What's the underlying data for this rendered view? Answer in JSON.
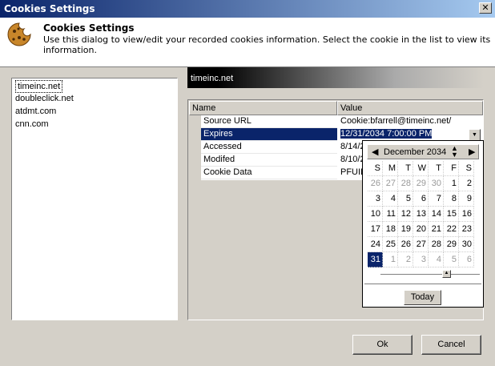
{
  "window": {
    "title": "Cookies Settings",
    "close": "✕"
  },
  "header": {
    "title": "Cookies Settings",
    "description": "Use this dialog to view/edit your recorded cookies information. Select the cookie in the list to view its information."
  },
  "cookies": [
    "timeinc.net",
    "doubleclick.net",
    "atdmt.com",
    "cnn.com"
  ],
  "selected_cookie": "timeinc.net",
  "grid": {
    "columns": [
      "Name",
      "Value"
    ],
    "rows": [
      {
        "name": "Source URL",
        "value": "Cookie:bfarrell@timeinc.net/"
      },
      {
        "name": "Expires",
        "value": "12/31/2034 7:00:00 PM"
      },
      {
        "name": "Accessed",
        "value": "8/14/2"
      },
      {
        "name": "Modifed",
        "value": "8/10/2"
      },
      {
        "name": "Cookie Data",
        "value": "PFUID"
      }
    ]
  },
  "calendar": {
    "month": "December 2034",
    "weekdays": [
      "S",
      "M",
      "T",
      "W",
      "T",
      "F",
      "S"
    ],
    "days": [
      [
        26,
        27,
        28,
        29,
        30,
        1,
        2
      ],
      [
        3,
        4,
        5,
        6,
        7,
        8,
        9
      ],
      [
        10,
        11,
        12,
        13,
        14,
        15,
        16
      ],
      [
        17,
        18,
        19,
        20,
        21,
        22,
        23
      ],
      [
        24,
        25,
        26,
        27,
        28,
        29,
        30
      ],
      [
        31,
        1,
        2,
        3,
        4,
        5,
        6
      ]
    ],
    "selected_day": 31,
    "today_label": "Today"
  },
  "buttons": {
    "ok": "Ok",
    "cancel": "Cancel"
  }
}
